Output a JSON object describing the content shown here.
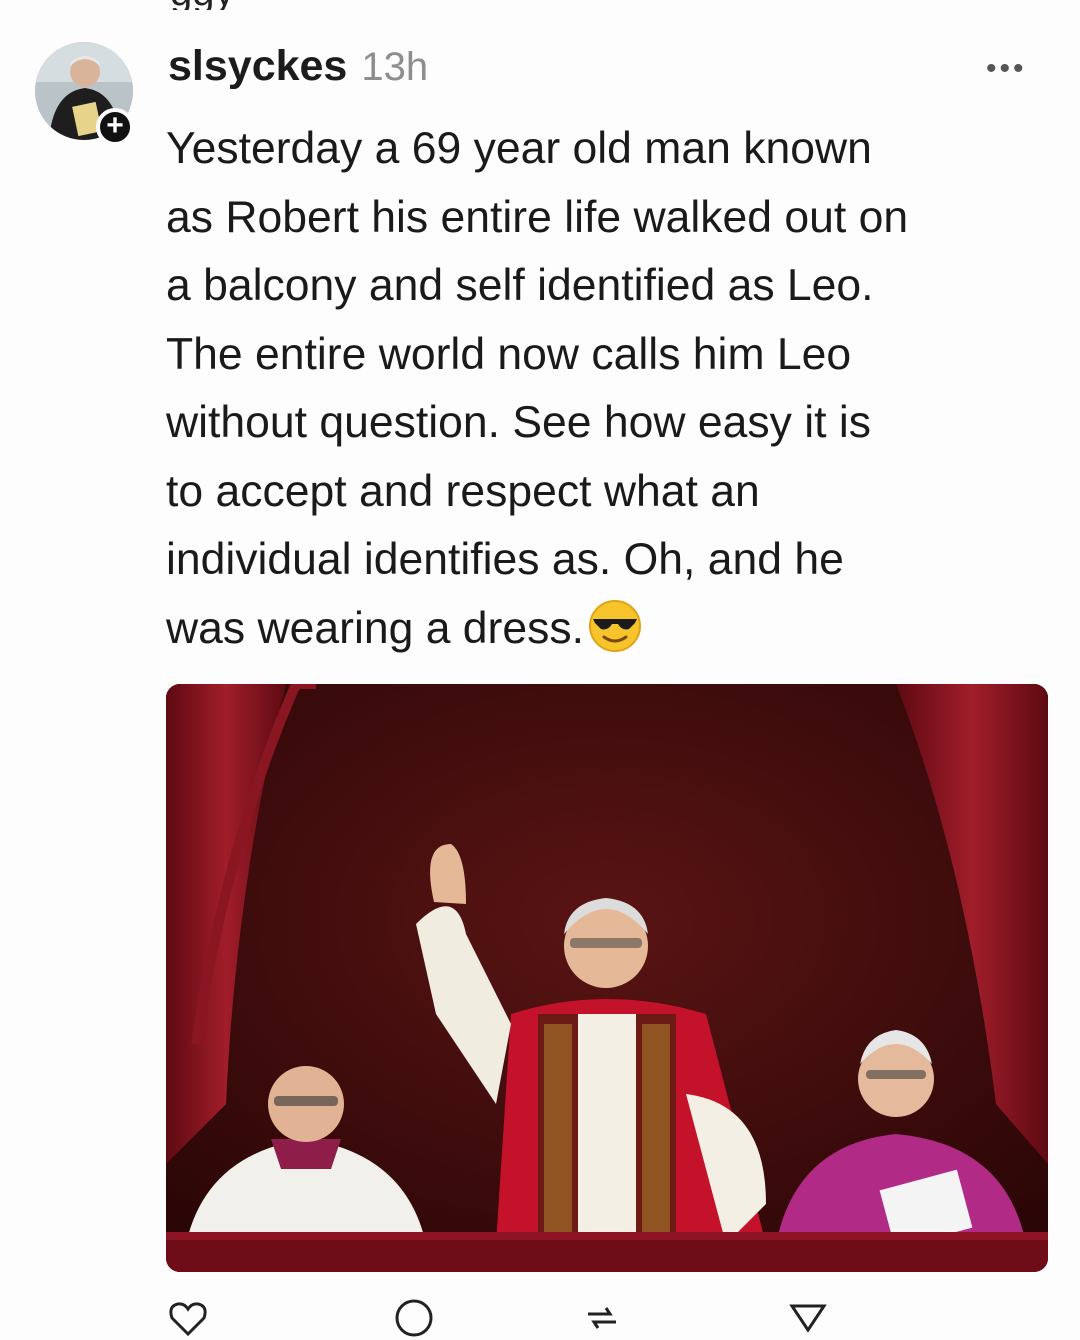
{
  "post": {
    "username": "slsyckes",
    "time": "13h",
    "more_label": "•••",
    "text": "Yesterday a 69 year old man known\nas Robert his entire life walked out on\na balcony and self identified as Leo.\nThe entire world now calls him Leo\nwithout question. See how easy it is\nto accept and respect what an\nindividual identifies as. Oh, and he\nwas wearing a dress.",
    "emoji": "smiling-face-with-sunglasses",
    "follow_label": "+"
  },
  "icons": {
    "avatar": "profile-photo",
    "follow": "plus-icon",
    "more": "more-options-icon",
    "actions": [
      "heart-icon",
      "comment-icon",
      "repost-icon",
      "share-icon"
    ]
  },
  "colors": {
    "text": "#1a1a1a",
    "muted": "#8e8e8e",
    "background": "#fdfdfd",
    "curtain": "#7a0f18",
    "vestment_red": "#c4122a",
    "vestment_purple": "#a12a7a"
  }
}
